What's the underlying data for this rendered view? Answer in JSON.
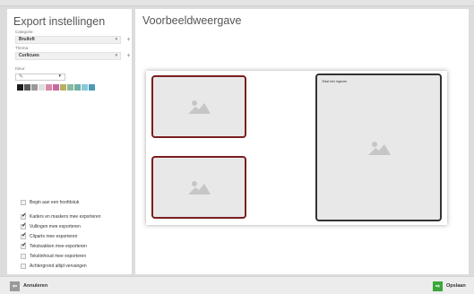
{
  "left_panel": {
    "title": "Export instellingen",
    "categorie_label": "Categorie:",
    "categorie_value": "Bruiloft",
    "thema_label": "Thema:",
    "thema_value": "Curlicues",
    "kleur_label": "Kleur:",
    "swatches": [
      "#1c1c1c",
      "#5a5a5a",
      "#9a9a9a",
      "#e0e0e0",
      "#d88aa8",
      "#c86aa0",
      "#b8b060",
      "#8ab8a0",
      "#70b0a8",
      "#8ac8d8",
      "#4a9ab8"
    ],
    "checkboxes": [
      {
        "label": "Begin aan een hoofdstuk",
        "checked": false
      },
      {
        "label": "Kaders en maskers mee exporteren",
        "checked": true
      },
      {
        "label": "Vullingen mee exporteren",
        "checked": true
      },
      {
        "label": "Cliparts mee exporteren",
        "checked": true
      },
      {
        "label": "Tekstvakken mee exporteren",
        "checked": true
      },
      {
        "label": "Tekstinhoud mee exporteren",
        "checked": false
      },
      {
        "label": "Achtergrond altijd vervangen",
        "checked": false
      }
    ]
  },
  "right_panel": {
    "title": "Voorbeeldweergave",
    "textbox_placeholder": "Tekst hier ingeven"
  },
  "footer": {
    "cancel_label": "Annuleren",
    "save_label": "Opslaan"
  },
  "colors": {
    "frame_border": "#7a1e1e",
    "save_green": "#3aa63a",
    "cancel_gray": "#9a9a9a"
  }
}
